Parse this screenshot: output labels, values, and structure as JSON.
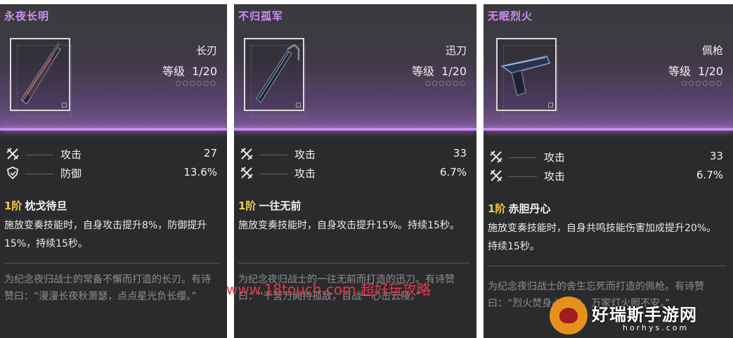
{
  "cards": [
    {
      "title": "永夜长明",
      "weapon_type": "长刃",
      "level_label": "等级",
      "level_value": "1/20",
      "dots": "○○○○○○",
      "stats": [
        {
          "icon": "attack-icon",
          "name": "攻击",
          "value": "27"
        },
        {
          "icon": "defense-icon",
          "name": "防御",
          "value": "13.6%"
        }
      ],
      "rank_level": "1阶",
      "rank_name": "枕戈待旦",
      "description": "施放变奏技能时，自身攻击提升8%，防御提升15%，持续15秒。",
      "lore": "为纪念夜归战士的常备不懈而打造的长刃。有诗赞曰：“漫漫长夜秋萧瑟，点点星光负长缨。”"
    },
    {
      "title": "不归孤军",
      "weapon_type": "迅刀",
      "level_label": "等级",
      "level_value": "1/20",
      "dots": "○○○○○○",
      "stats": [
        {
          "icon": "attack-icon",
          "name": "攻击",
          "value": "33"
        },
        {
          "icon": "attack-icon",
          "name": "攻击",
          "value": "6.7%"
        }
      ],
      "rank_level": "1阶",
      "rank_name": "一往无前",
      "description": "施放变奏技能时，自身攻击提升15%。持续15秒。",
      "lore": "为纪念夜归战士的一往无前而打造的迅刀。有诗赞曰：“千营万阙持孤敌，百战一心击云陵。”"
    },
    {
      "title": "无眠烈火",
      "weapon_type": "佩枪",
      "level_label": "等级",
      "level_value": "1/20",
      "dots": "○○○○○○",
      "stats": [
        {
          "icon": "attack-icon",
          "name": "攻击",
          "value": "33"
        },
        {
          "icon": "attack-icon",
          "name": "攻击",
          "value": "6.7%"
        }
      ],
      "rank_level": "1阶",
      "rank_name": "赤胆丹心",
      "description": "施放变奏技能时，自身共鸣技能伤害加成提升20%。持续15秒。",
      "lore": "为纪念夜归战士的舍生忘死而打造的佩枪。有诗赞曰：“烈火焚身心不改，万家灯火照不安。”"
    }
  ],
  "watermarks": {
    "site": "www.18touch.com 超好玩攻略",
    "brand": "好瑞斯手游网",
    "brand_sub": "horhys.com"
  }
}
